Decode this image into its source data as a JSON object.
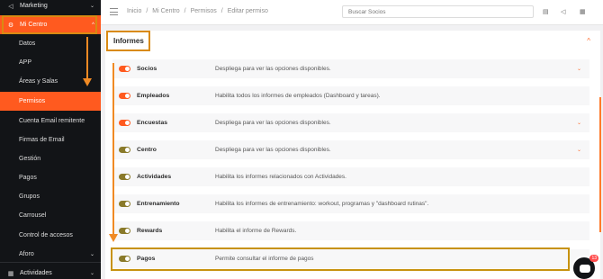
{
  "sidebar": {
    "marketing": "Marketing",
    "mi_centro": "Mi Centro",
    "items": [
      {
        "label": "Datos"
      },
      {
        "label": "APP"
      },
      {
        "label": "Áreas y Salas"
      },
      {
        "label": "Permisos"
      },
      {
        "label": "Cuenta Email remitente"
      },
      {
        "label": "Firmas de Email"
      },
      {
        "label": "Gestión"
      },
      {
        "label": "Pagos"
      },
      {
        "label": "Grupos"
      },
      {
        "label": "Carrousel"
      },
      {
        "label": "Control de accesos"
      },
      {
        "label": "Aforo"
      }
    ],
    "actividades": "Actividades"
  },
  "topbar": {
    "crumbs": [
      "Inicio",
      "/",
      "Mi Centro",
      "/",
      "Permisos",
      "/",
      "Editar permiso"
    ],
    "search_placeholder": "Buscar Socios"
  },
  "card": {
    "title": "Informes",
    "rows": [
      {
        "name": "Socios",
        "desc": "Despliega para ver las opciones disponibles.",
        "expand": "⌄"
      },
      {
        "name": "Empleados",
        "desc": "Habilita todos los informes de empleados (Dashboard y tareas).",
        "expand": ""
      },
      {
        "name": "Encuestas",
        "desc": "Despliega para ver las opciones disponibles.",
        "expand": "⌄"
      },
      {
        "name": "Centro",
        "desc": "Despliega para ver las opciones disponibles.",
        "expand": "⌄"
      },
      {
        "name": "Actividades",
        "desc": "Habilita los informes relacionados con Actividades.",
        "expand": ""
      },
      {
        "name": "Entrenamiento",
        "desc": "Habilita los informes de entrenamiento: workout, programas y \"dashboard rutinas\".",
        "expand": ""
      },
      {
        "name": "Rewards",
        "desc": "Habilita el informe de Rewards.",
        "expand": ""
      },
      {
        "name": "Pagos",
        "desc": "Permite consultar el informe de pagos",
        "expand": ""
      }
    ]
  },
  "chat": {
    "badge": "13"
  },
  "colors": {
    "accent": "#ff5a1f",
    "sidebar_bg": "#121417",
    "highlight": "#d98a12"
  }
}
